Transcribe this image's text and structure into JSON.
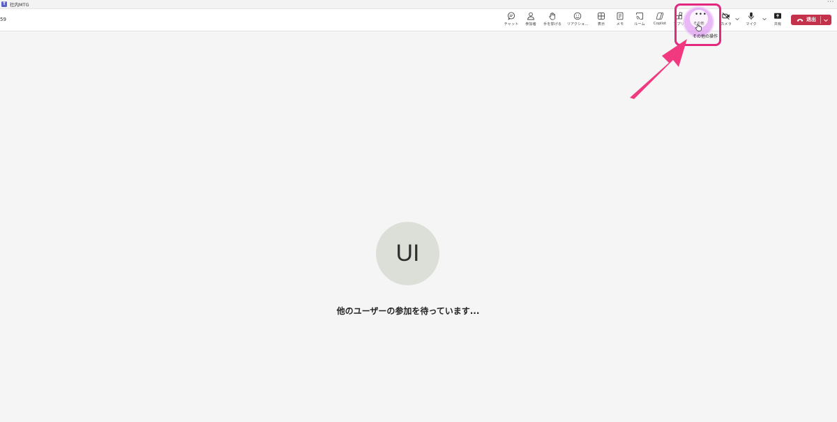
{
  "window": {
    "app_icon_text": "T",
    "title": "社内MTG",
    "menu": "···"
  },
  "meeting": {
    "timer": "59"
  },
  "toolbar": {
    "chat": "チャット",
    "people": "参加者",
    "raise_hand": "手を挙げる",
    "react": "リアクショ...",
    "view": "表示",
    "notes": "メモ",
    "rooms": "ルーム",
    "copilot": "Copilot",
    "apps": "アプリ",
    "more": "その他",
    "camera": "カメラ",
    "mic": "マイク",
    "share": "共有",
    "leave": "退出"
  },
  "tooltip": "その他の操作",
  "stage": {
    "avatar_initials": "UI",
    "waiting_message": "他のユーザーの参加を待っています..."
  },
  "colors": {
    "leave": "#c4314b",
    "highlight": "#e4277f",
    "arrow": "#f0397f",
    "avatar_bg": "#dcdfd8"
  }
}
